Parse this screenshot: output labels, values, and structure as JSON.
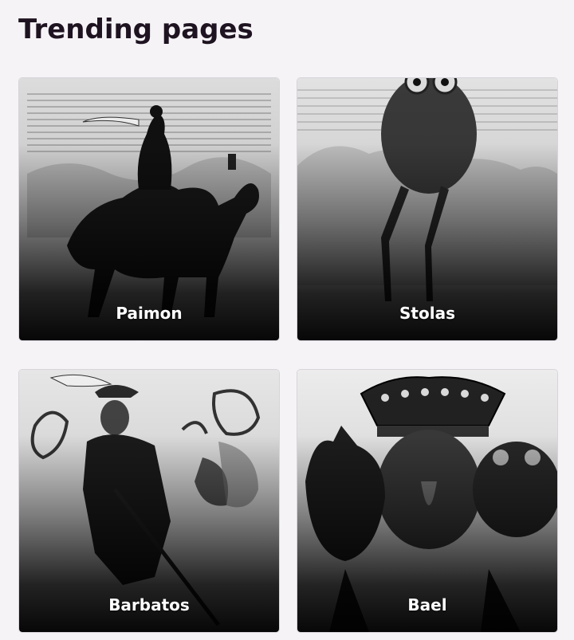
{
  "section": {
    "title": "Trending pages"
  },
  "cards": [
    {
      "label": "Paimon",
      "icon": "camel-rider-engraving"
    },
    {
      "label": "Stolas",
      "icon": "owl-engraving"
    },
    {
      "label": "Barbatos",
      "icon": "hunter-with-horns-engraving"
    },
    {
      "label": "Bael",
      "icon": "crowned-three-heads-engraving"
    }
  ]
}
